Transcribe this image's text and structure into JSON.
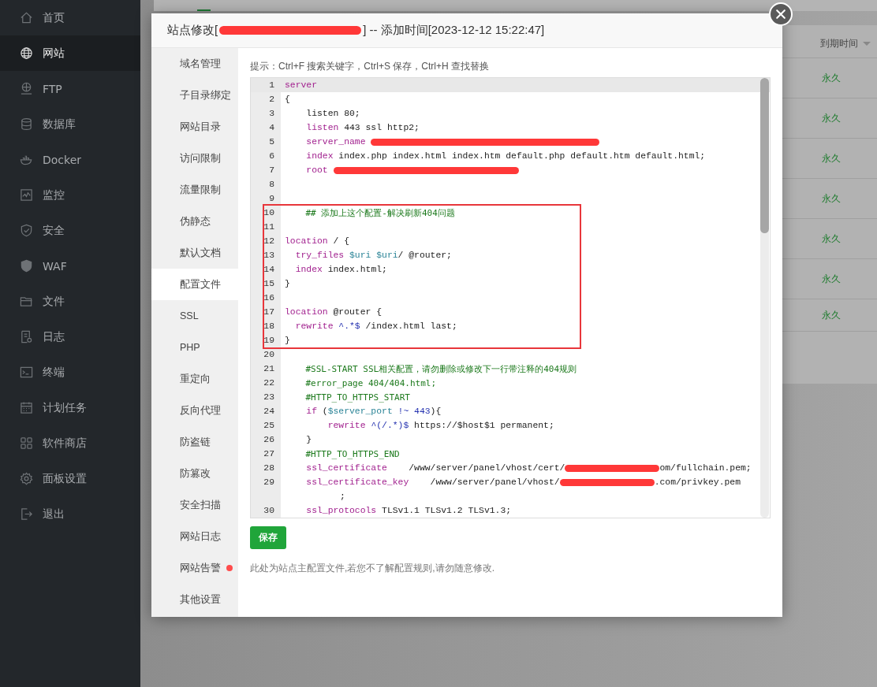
{
  "sidebar": {
    "items": [
      {
        "label": "首页",
        "selected": false
      },
      {
        "label": "网站",
        "selected": true
      },
      {
        "label": "FTP",
        "selected": false
      },
      {
        "label": "数据库",
        "selected": false
      },
      {
        "label": "Docker",
        "selected": false
      },
      {
        "label": "监控",
        "selected": false
      },
      {
        "label": "安全",
        "selected": false
      },
      {
        "label": "WAF",
        "selected": false
      },
      {
        "label": "文件",
        "selected": false
      },
      {
        "label": "日志",
        "selected": false
      },
      {
        "label": "终端",
        "selected": false
      },
      {
        "label": "计划任务",
        "selected": false
      },
      {
        "label": "软件商店",
        "selected": false
      },
      {
        "label": "面板设置",
        "selected": false
      },
      {
        "label": "退出",
        "selected": false
      }
    ]
  },
  "background_table": {
    "column_header": "到期时间",
    "rows": [
      "永久",
      "永久",
      "永久",
      "永久",
      "永久",
      "永久",
      "永久"
    ]
  },
  "modal": {
    "title_prefix": "站点修改[",
    "title_suffix": "] -- 添加时间[2023-12-12 15:22:47]",
    "tabs": [
      {
        "label": "域名管理",
        "selected": false,
        "alert": false
      },
      {
        "label": "子目录绑定",
        "selected": false,
        "alert": false
      },
      {
        "label": "网站目录",
        "selected": false,
        "alert": false
      },
      {
        "label": "访问限制",
        "selected": false,
        "alert": false
      },
      {
        "label": "流量限制",
        "selected": false,
        "alert": false
      },
      {
        "label": "伪静态",
        "selected": false,
        "alert": false
      },
      {
        "label": "默认文档",
        "selected": false,
        "alert": false
      },
      {
        "label": "配置文件",
        "selected": true,
        "alert": false
      },
      {
        "label": "SSL",
        "selected": false,
        "alert": false
      },
      {
        "label": "PHP",
        "selected": false,
        "alert": false
      },
      {
        "label": "重定向",
        "selected": false,
        "alert": false
      },
      {
        "label": "反向代理",
        "selected": false,
        "alert": false
      },
      {
        "label": "防盗链",
        "selected": false,
        "alert": false
      },
      {
        "label": "防篡改",
        "selected": false,
        "alert": false
      },
      {
        "label": "安全扫描",
        "selected": false,
        "alert": false
      },
      {
        "label": "网站日志",
        "selected": false,
        "alert": false
      },
      {
        "label": "网站告警",
        "selected": false,
        "alert": true
      },
      {
        "label": "其他设置",
        "selected": false,
        "alert": false
      }
    ],
    "hint": "提示：Ctrl+F 搜索关键字，Ctrl+S 保存，Ctrl+H 查找替换",
    "code_lines": [
      {
        "n": "1",
        "active": true,
        "tokens": [
          {
            "kind": "keyword",
            "text": "server"
          }
        ]
      },
      {
        "n": "2",
        "active": false,
        "tokens": [
          {
            "kind": "plain",
            "text": "{"
          }
        ]
      },
      {
        "n": "3",
        "active": false,
        "tokens": [
          {
            "kind": "plain",
            "text": "    listen 80;"
          }
        ]
      },
      {
        "n": "4",
        "active": false,
        "tokens": [
          {
            "kind": "keyword",
            "text": "    listen"
          },
          {
            "kind": "plain",
            "text": " 443 ssl http2;"
          }
        ]
      },
      {
        "n": "5",
        "active": false,
        "tokens": [
          {
            "kind": "keyword",
            "text": "    server_name "
          },
          {
            "kind": "redaction"
          }
        ]
      },
      {
        "n": "6",
        "active": false,
        "tokens": [
          {
            "kind": "keyword",
            "text": "    index"
          },
          {
            "kind": "plain",
            "text": " index.php index.html index.htm default.php default.htm default.html;"
          }
        ]
      },
      {
        "n": "7",
        "active": false,
        "tokens": [
          {
            "kind": "keyword",
            "text": "    root "
          },
          {
            "kind": "redaction"
          }
        ]
      },
      {
        "n": "8",
        "active": false
      },
      {
        "n": "9",
        "active": false
      },
      {
        "n": "10",
        "active": false,
        "tokens": [
          {
            "kind": "comment",
            "text": "    ## 添加上这个配置-解决刷新404问题"
          }
        ]
      },
      {
        "n": "11",
        "active": false
      },
      {
        "n": "12",
        "active": false,
        "tokens": [
          {
            "kind": "keyword",
            "text": "location"
          },
          {
            "kind": "plain",
            "text": " / {"
          }
        ]
      },
      {
        "n": "13",
        "active": false,
        "tokens": [
          {
            "kind": "keyword",
            "text": "  try_files "
          },
          {
            "kind": "variable",
            "text": "$uri "
          },
          {
            "kind": "variable",
            "text": "$uri"
          },
          {
            "kind": "plain",
            "text": "/ @router;"
          }
        ]
      },
      {
        "n": "14",
        "active": false,
        "tokens": [
          {
            "kind": "keyword",
            "text": "  index"
          },
          {
            "kind": "plain",
            "text": " index.html;"
          }
        ]
      },
      {
        "n": "15",
        "active": false,
        "tokens": [
          {
            "kind": "plain",
            "text": "}"
          }
        ]
      },
      {
        "n": "16",
        "active": false
      },
      {
        "n": "17",
        "active": false,
        "tokens": [
          {
            "kind": "keyword",
            "text": "location"
          },
          {
            "kind": "plain",
            "text": " @router {"
          }
        ]
      },
      {
        "n": "18",
        "active": false,
        "tokens": [
          {
            "kind": "keyword",
            "text": "  rewrite "
          },
          {
            "kind": "regex",
            "text": "^.*$"
          },
          {
            "kind": "plain",
            "text": " /index.html last;"
          }
        ]
      },
      {
        "n": "19",
        "active": false,
        "tokens": [
          {
            "kind": "plain",
            "text": "}"
          }
        ]
      },
      {
        "n": "20",
        "active": false
      },
      {
        "n": "21",
        "active": false,
        "tokens": [
          {
            "kind": "comment",
            "text": "    #SSL-START SSL相关配置，请勿删除或修改下一行带注释的404规则"
          }
        ]
      },
      {
        "n": "22",
        "active": false,
        "tokens": [
          {
            "kind": "comment",
            "text": "    #error_page 404/404.html;"
          }
        ]
      },
      {
        "n": "23",
        "active": false,
        "tokens": [
          {
            "kind": "comment",
            "text": "    #HTTP_TO_HTTPS_START"
          }
        ]
      },
      {
        "n": "24",
        "active": false,
        "tokens": [
          {
            "kind": "keyword",
            "text": "    if"
          },
          {
            "kind": "plain",
            "text": " ("
          },
          {
            "kind": "variable",
            "text": "$server_port "
          },
          {
            "kind": "regex",
            "text": "!~ 443"
          },
          {
            "kind": "plain",
            "text": "){"
          }
        ]
      },
      {
        "n": "25",
        "active": false,
        "tokens": [
          {
            "kind": "keyword",
            "text": "        rewrite "
          },
          {
            "kind": "regex",
            "text": "^(/.*)$"
          },
          {
            "kind": "plain",
            "text": " https://$host$1 permanent;"
          }
        ]
      },
      {
        "n": "26",
        "active": false,
        "tokens": [
          {
            "kind": "plain",
            "text": "    }"
          }
        ]
      },
      {
        "n": "27",
        "active": false,
        "tokens": [
          {
            "kind": "comment",
            "text": "    #HTTP_TO_HTTPS_END"
          }
        ]
      },
      {
        "n": "28",
        "active": false,
        "tokens": [
          {
            "kind": "keyword",
            "text": "    ssl_certificate"
          },
          {
            "kind": "plain",
            "text": "    /www/server/panel/vhost/cert/"
          },
          {
            "kind": "redaction"
          },
          {
            "kind": "plain",
            "text": "om/fullchain.pem;"
          }
        ]
      },
      {
        "n": "29",
        "active": false,
        "tokens": [
          {
            "kind": "keyword",
            "text": "    ssl_certificate_key"
          },
          {
            "kind": "plain",
            "text": "    /www/server/panel/vhost/"
          },
          {
            "kind": "redaction"
          },
          {
            "kind": "plain",
            "text": ".com/privkey.pem"
          }
        ],
        "continuation": ";"
      },
      {
        "n": "30",
        "active": false,
        "tokens": [
          {
            "kind": "keyword",
            "text": "    ssl_protocols"
          },
          {
            "kind": "plain",
            "text": " TLSv1.1 TLSv1.2 TLSv1.3;"
          }
        ]
      }
    ],
    "save_button": "保存",
    "note": "此处为站点主配置文件,若您不了解配置规则,请勿随意修改."
  }
}
